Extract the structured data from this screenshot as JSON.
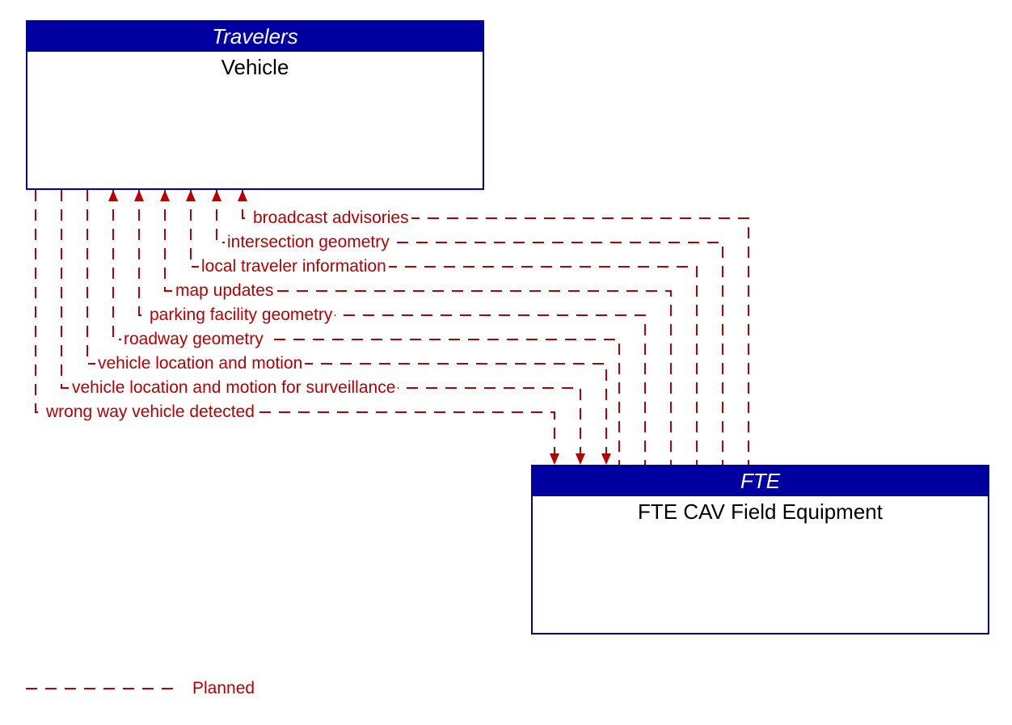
{
  "box_top": {
    "header": "Travelers",
    "title": "Vehicle"
  },
  "box_bottom": {
    "header": "FTE",
    "title": "FTE CAV Field Equipment"
  },
  "flows": {
    "f0": "broadcast advisories",
    "f1": "intersection geometry",
    "f2": "local traveler information",
    "f3": "map updates",
    "f4": "parking facility geometry",
    "f5": "roadway geometry",
    "f6": "vehicle location and motion",
    "f7": "vehicle location and motion for surveillance",
    "f8": "wrong way vehicle detected"
  },
  "legend": {
    "label": "Planned"
  },
  "colors": {
    "header_bg": "#0000a0",
    "flow": "#b70000"
  }
}
